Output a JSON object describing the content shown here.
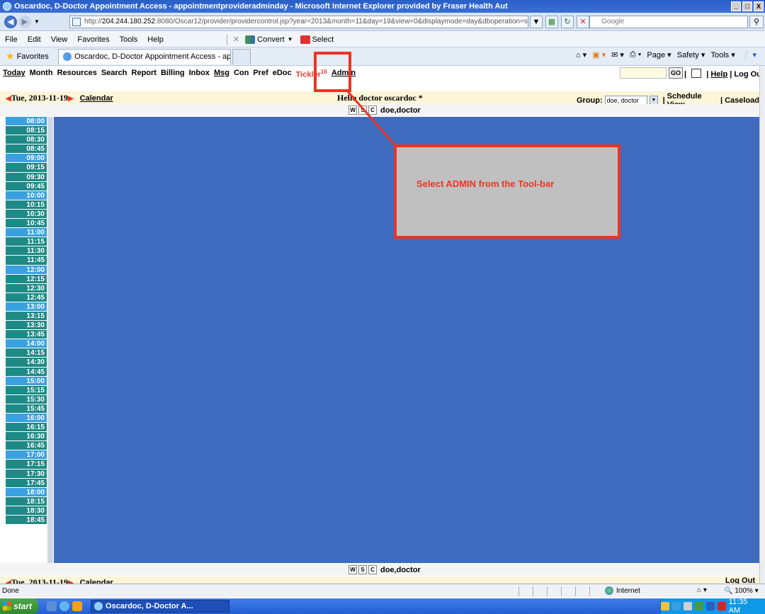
{
  "window": {
    "title": "Oscardoc, D-Doctor Appointment Access - appointmentprovideradminday - Microsoft Internet Explorer provided by Fraser Health Aut",
    "controls": [
      "_",
      "□",
      "X"
    ]
  },
  "address": {
    "url_prefix": "http://",
    "url_host": "204.244.180.252",
    "url_rest": ":8080/Oscar12/provider/providercontrol.jsp?year=2013&month=11&day=19&view=0&displaymode=day&dboperation=searchappointm",
    "search_placeholder": "Google"
  },
  "menubar": {
    "items": [
      "File",
      "Edit",
      "View",
      "Favorites",
      "Tools",
      "Help"
    ],
    "convert_label": "Convert",
    "select_label": "Select"
  },
  "tabbar": {
    "favorites_label": "Favorites",
    "tab_title": "Oscardoc, D-Doctor Appointment Access - appointme...",
    "page_label": "Page",
    "safety_label": "Safety",
    "tools_label": "Tools"
  },
  "oscar": {
    "menu": {
      "today": "Today",
      "month": "Month",
      "resources": "Resources",
      "search": "Search",
      "report": "Report",
      "billing": "Billing",
      "inbox": "Inbox",
      "msg": "Msg",
      "con": "Con",
      "pref": "Pref",
      "edoc": "eDoc",
      "tickler": "Tickler",
      "tickler_count": "16",
      "admin": "Admin"
    },
    "go_label": "GO",
    "help_label": "Help",
    "logout_label": "Log Out",
    "date": "Tue, 2013-11-19",
    "calendar_label": "Calendar",
    "greeting": "Hello doctor oscardoc *",
    "group_label": "Group:",
    "group_value": "doe, doctor",
    "schedule_view_label": "Schedule View",
    "caseload_label": "Caseload",
    "provider_name": "doe,doctor",
    "provider_buttons": [
      "W",
      "S",
      "C"
    ],
    "times": [
      "08:00",
      "08:15",
      "08:30",
      "08:45",
      "09:00",
      "09:15",
      "09:30",
      "09:45",
      "10:00",
      "10:15",
      "10:30",
      "10:45",
      "11:00",
      "11:15",
      "11:30",
      "11:45",
      "12:00",
      "12:15",
      "12:30",
      "12:45",
      "13:00",
      "13:15",
      "13:30",
      "13:45",
      "14:00",
      "14:15",
      "14:30",
      "14:45",
      "15:00",
      "15:15",
      "15:30",
      "15:45",
      "16:00",
      "16:15",
      "16:30",
      "16:45",
      "17:00",
      "17:15",
      "17:30",
      "17:45",
      "18:00",
      "18:15",
      "18:30",
      "18:45"
    ]
  },
  "status": {
    "left": "Done",
    "zone": "Internet",
    "zoom": "100%"
  },
  "taskbar": {
    "start": "start",
    "item": "Oscardoc, D-Doctor A...",
    "clock": "11:35 AM"
  },
  "annotation": {
    "callout_text": "Select ADMIN from the Tool-bar",
    "color": "#ee3322"
  }
}
